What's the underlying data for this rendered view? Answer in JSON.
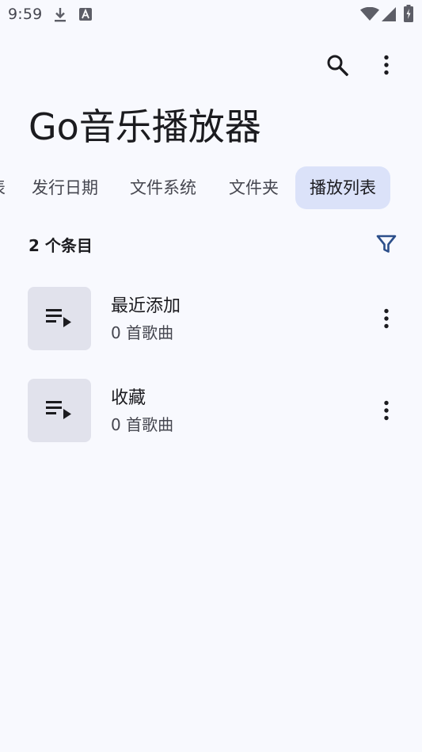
{
  "status_bar": {
    "time": "9:59",
    "icons": [
      "download-icon",
      "app-store-icon",
      "wifi-icon",
      "cell-signal-icon",
      "battery-icon"
    ]
  },
  "app_bar": {
    "actions": [
      "search-icon",
      "more-vert-icon"
    ]
  },
  "page": {
    "title": "Go音乐播放器"
  },
  "tabs": [
    {
      "label": "表",
      "active": false
    },
    {
      "label": "发行日期",
      "active": false
    },
    {
      "label": "文件系统",
      "active": false
    },
    {
      "label": "文件夹",
      "active": false
    },
    {
      "label": "播放列表",
      "active": true
    }
  ],
  "list_header": {
    "count": "2 个条目",
    "filter_icon": "filter-icon"
  },
  "playlists": [
    {
      "title": "最近添加",
      "subtitle": "0 首歌曲",
      "icon": "playlist-play-icon"
    },
    {
      "title": "收藏",
      "subtitle": "0 首歌曲",
      "icon": "playlist-play-icon"
    }
  ],
  "colors": {
    "background": "#f8f9fe",
    "active_tab": "#dbe2f9",
    "thumbnail": "#e1e2ec",
    "accent": "#2c4f8a",
    "text_primary": "#1b1b1f",
    "text_secondary": "#45464f"
  }
}
